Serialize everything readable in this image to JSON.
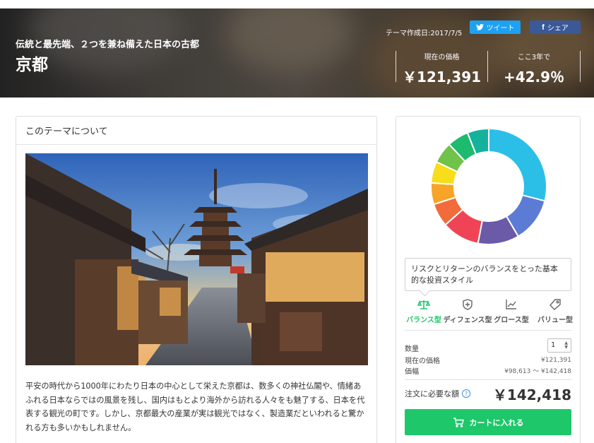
{
  "hero": {
    "subtitle": "伝統と最先端、２つを兼ね備えた日本の古都",
    "title": "京都",
    "created": "テーマ作成日:2017/7/5",
    "tweet_label": "ツイート",
    "share_label": "シェア",
    "current_price_label": "現在の価格",
    "current_price_value": "￥121,391",
    "three_year_label": "ここ3年で",
    "three_year_value": "+42.9％"
  },
  "about": {
    "heading": "このテーマについて",
    "body": "平安の時代から1000年にわたり日本の中心として栄えた京都は、数多くの神社仏閣や、情緒あふれる日本ならではの風景を残し、国内はもとより海外から訪れる人々をも魅了する、日本を代表する観光の町です。しかし、京都最大の産業が実は観光ではなく、製造業だといわれると驚かれる方も多いかもしれません。"
  },
  "allocation": {
    "segments": [
      {
        "color": "#2bbfe8",
        "value": 29.0
      },
      {
        "color": "#5b7bd5",
        "value": 12.5
      },
      {
        "color": "#6a5aa8",
        "value": 11.5
      },
      {
        "color": "#ef4455",
        "value": 10.5
      },
      {
        "color": "#f26b3a",
        "value": 6.5
      },
      {
        "color": "#f7a428",
        "value": 6.0
      },
      {
        "color": "#f7dd1a",
        "value": 6.0
      },
      {
        "color": "#6fc24a",
        "value": 6.0
      },
      {
        "color": "#1eba6e",
        "value": 6.0
      },
      {
        "color": "#14b29c",
        "value": 6.0
      }
    ]
  },
  "tooltip": "リスクとリターンのバランスをとった基本的な投資スタイル",
  "styles": [
    {
      "label": "バランス型",
      "icon": "scale-icon",
      "active": true
    },
    {
      "label": "ディフェンス型",
      "icon": "shield-icon",
      "active": false
    },
    {
      "label": "グロース型",
      "icon": "chart-icon",
      "active": false
    },
    {
      "label": "バリュー型",
      "icon": "tag-icon",
      "active": false
    }
  ],
  "order": {
    "qty_label": "数量",
    "qty_value": "1",
    "current_label": "現在の価格",
    "current_value": "¥121,391",
    "range_label": "価幅",
    "range_value": "¥98,613 〜 ¥142,418",
    "total_label": "注文に必要な額",
    "total_value": "￥142,418",
    "cart_label": "カートに入れる"
  },
  "colors": {
    "accent": "#1ec76a",
    "twitter": "#1da1f2",
    "facebook": "#3b5998"
  }
}
